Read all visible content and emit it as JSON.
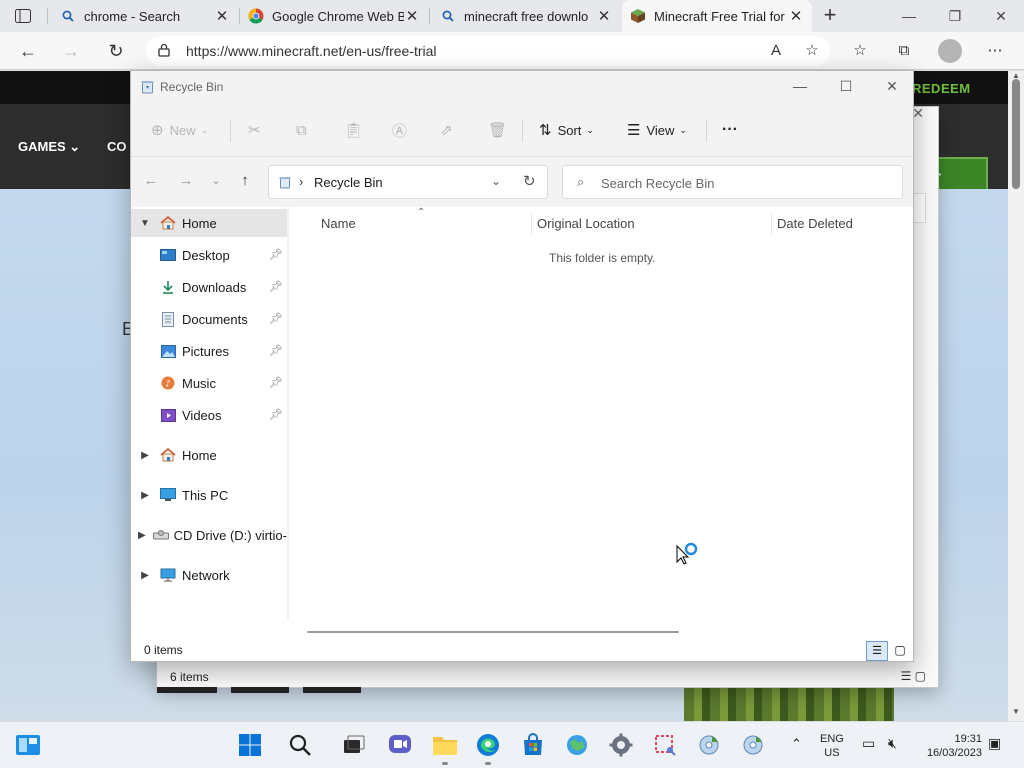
{
  "browser": {
    "tabs": [
      {
        "title": "chrome - Search",
        "icon": "search-icon"
      },
      {
        "title": "Google Chrome Web Br",
        "icon": "chrome-icon"
      },
      {
        "title": "minecraft free downlo",
        "icon": "search-icon"
      },
      {
        "title": "Minecraft Free Trial for",
        "icon": "minecraft-icon",
        "active": true
      }
    ],
    "url": "https://www.minecraft.net/en-us/free-trial"
  },
  "webpage": {
    "redeem_label": "REDEEM",
    "nav_games": "GAMES",
    "nav_partial": "CO",
    "buy_partial": "FT",
    "hero_partial": "E"
  },
  "background_window": {
    "status_count": "6 items"
  },
  "explorer": {
    "title": "Recycle Bin",
    "commands": {
      "new": "New",
      "sort": "Sort",
      "view": "View",
      "more": "···"
    },
    "address": {
      "location": "Recycle Bin"
    },
    "search": {
      "placeholder": "Search Recycle Bin"
    },
    "sidebar": {
      "items": [
        {
          "label": "Home",
          "icon": "home-icon",
          "expanded": true,
          "selected": true
        },
        {
          "label": "Desktop",
          "icon": "desktop-icon",
          "pinned": true
        },
        {
          "label": "Downloads",
          "icon": "download-icon",
          "pinned": true
        },
        {
          "label": "Documents",
          "icon": "documents-icon",
          "pinned": true
        },
        {
          "label": "Pictures",
          "icon": "pictures-icon",
          "pinned": true
        },
        {
          "label": "Music",
          "icon": "music-icon",
          "pinned": true
        },
        {
          "label": "Videos",
          "icon": "videos-icon",
          "pinned": true
        },
        {
          "label": "Home",
          "icon": "home-icon"
        },
        {
          "label": "This PC",
          "icon": "this-pc-icon"
        },
        {
          "label": "CD Drive (D:) virtio-",
          "icon": "cd-drive-icon"
        },
        {
          "label": "Network",
          "icon": "network-icon"
        }
      ]
    },
    "columns": [
      "Name",
      "Original Location",
      "Date Deleted"
    ],
    "empty_message": "This folder is empty.",
    "status_count": "0 items"
  },
  "taskbar": {
    "lang_line1": "ENG",
    "lang_line2": "US",
    "time": "19:31",
    "date": "16/03/2023"
  },
  "colors": {
    "accent": "#0067c0",
    "minecraft_green": "#3c8527"
  }
}
